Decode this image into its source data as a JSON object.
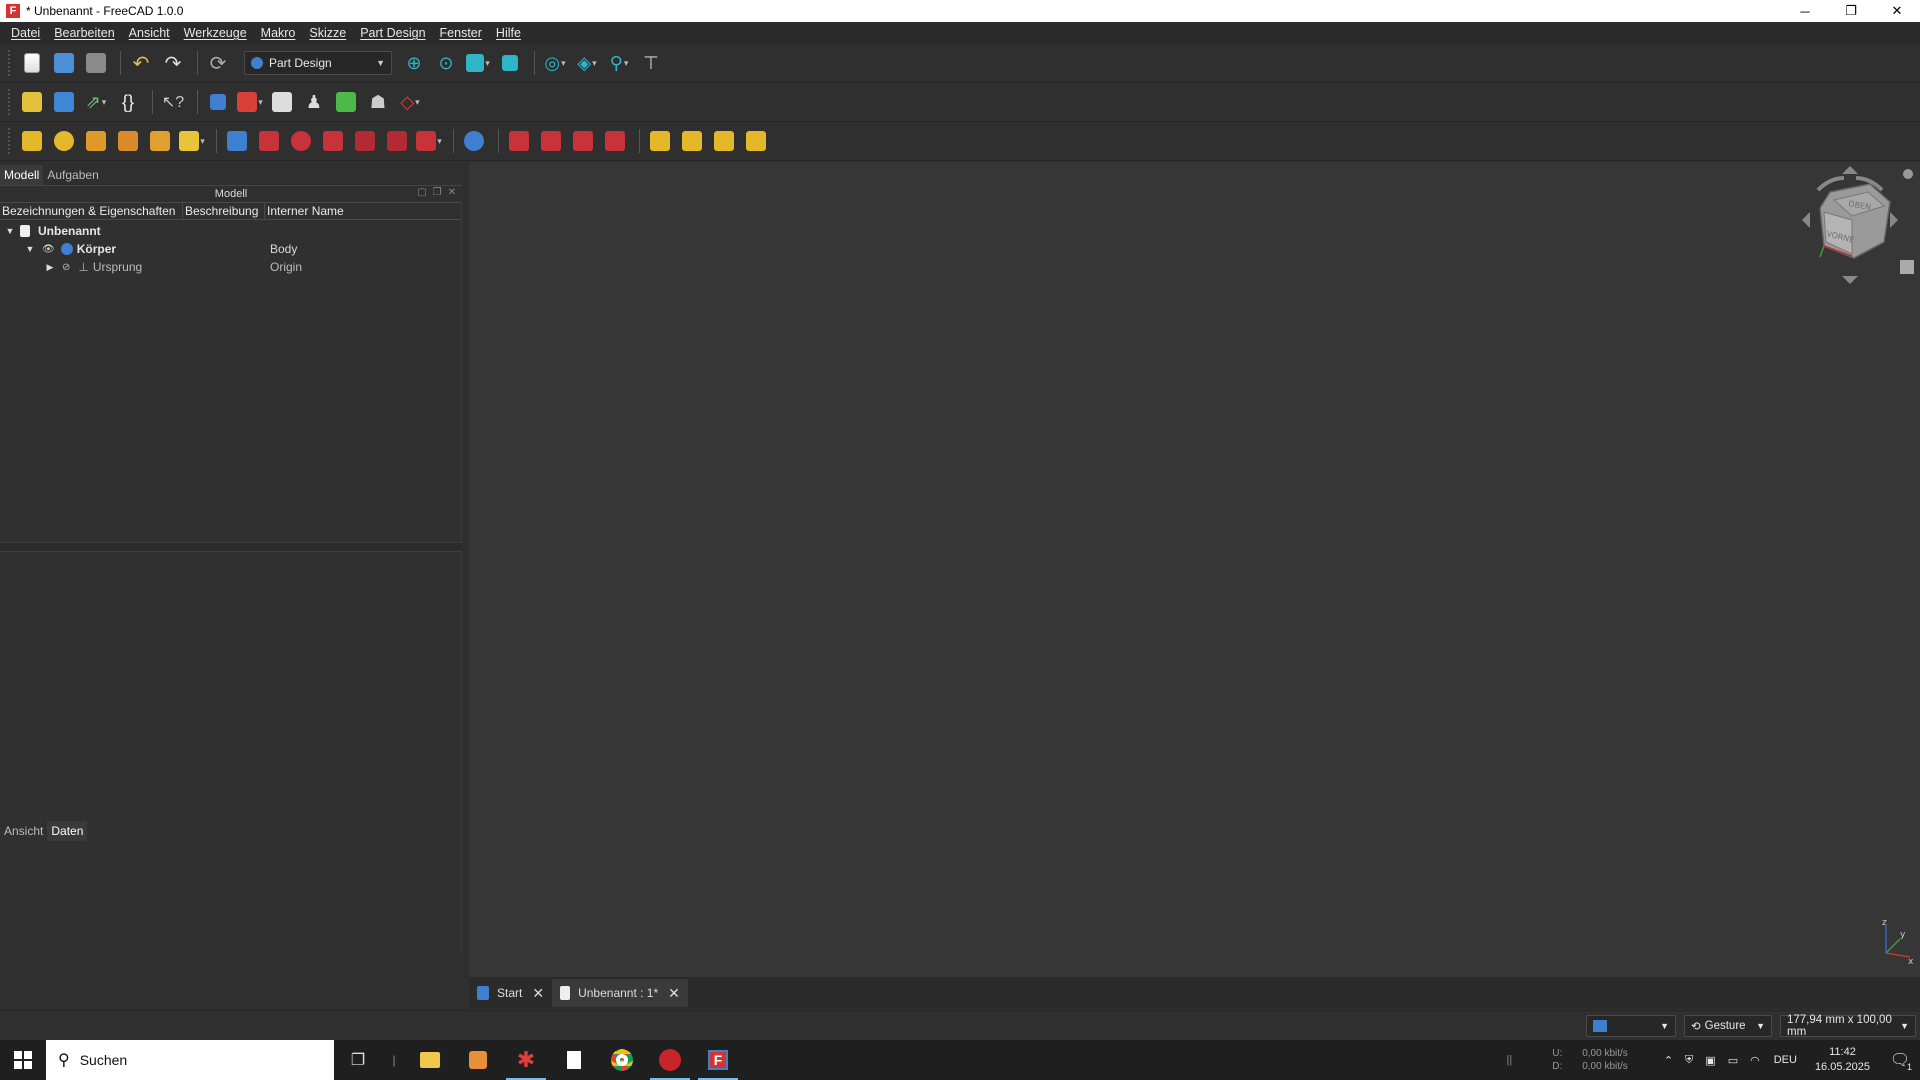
{
  "window": {
    "title": "* Unbenannt - FreeCAD 1.0.0",
    "app_icon": "F"
  },
  "menu": [
    "Datei",
    "Bearbeiten",
    "Ansicht",
    "Werkzeuge",
    "Makro",
    "Skizze",
    "Part Design",
    "Fenster",
    "Hilfe"
  ],
  "workbench": {
    "selected": "Part Design"
  },
  "panel": {
    "tabs": [
      "Modell",
      "Aufgaben"
    ],
    "header": "Modell",
    "columns": [
      "Bezeichnungen & Eigenschaften",
      "Beschreibung",
      "Interner Name"
    ],
    "tree": [
      {
        "name": "Unbenannt",
        "internal": ""
      },
      {
        "name": "Körper",
        "internal": "Body"
      },
      {
        "name": "Ursprung",
        "internal": "Origin"
      }
    ],
    "prop_tabs": [
      "Ansicht",
      "Daten"
    ]
  },
  "navcube": {
    "top_label": "OBEN",
    "front_label": "VORNE"
  },
  "axis": {
    "z": "z",
    "y": "y",
    "x": "x"
  },
  "doctabs": [
    {
      "label": "Start"
    },
    {
      "label": "Unbenannt : 1*"
    }
  ],
  "status": {
    "nav_style": "Gesture",
    "dimensions": "177,94 mm x 100,00 mm"
  },
  "taskbar": {
    "search_placeholder": "Suchen",
    "net_up_label": "U:",
    "net_down_label": "D:",
    "net_up": "0,00 kbit/s",
    "net_down": "0,00 kbit/s",
    "lang": "DEU",
    "time": "11:42",
    "date": "16.05.2025",
    "notifications": "1"
  },
  "colors": {
    "accent": "#3f7fd0",
    "freecad_red": "#d2352f",
    "viewport_bg": "#363636"
  }
}
